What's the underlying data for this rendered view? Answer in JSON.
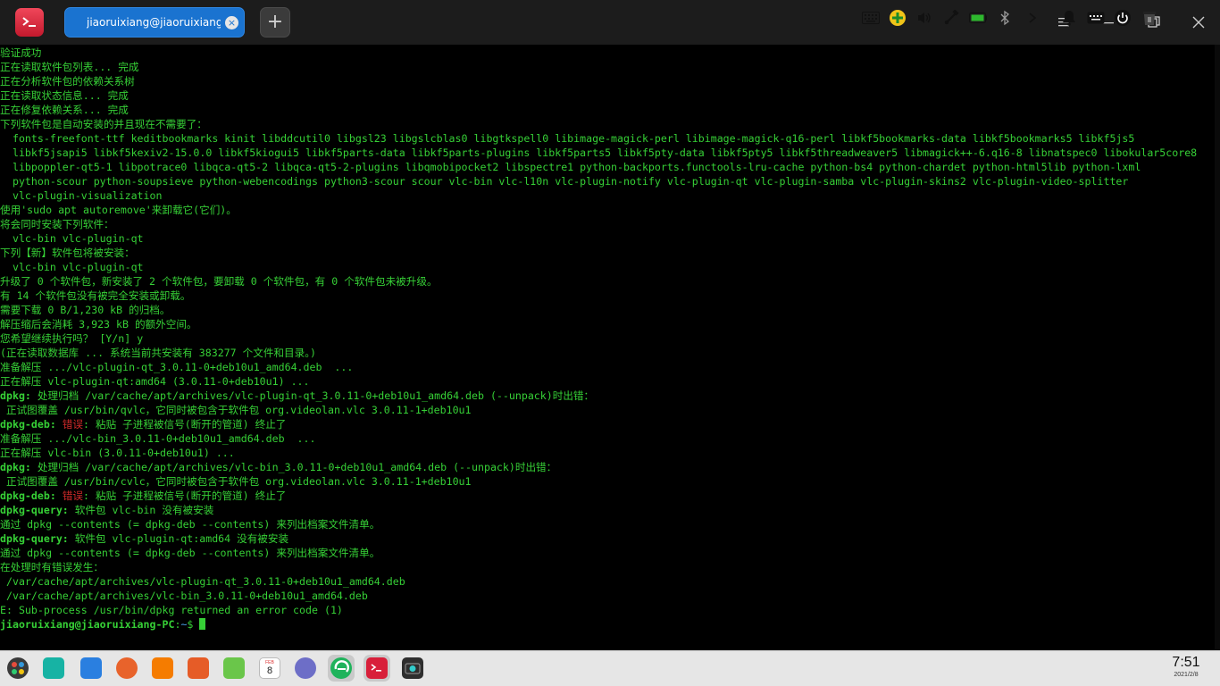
{
  "window": {
    "tab_title": "jiaoruixiang@jiaoruixiang-PC: ~",
    "tab_close_glyph": "×",
    "new_tab_glyph": "+"
  },
  "terminal": {
    "lines": [
      [
        {
          "t": "验证成功"
        }
      ],
      [
        {
          "t": "正在读取软件包列表... 完成"
        }
      ],
      [
        {
          "t": "正在分析软件包的依赖关系树"
        }
      ],
      [
        {
          "t": "正在读取状态信息... 完成"
        }
      ],
      [
        {
          "t": "正在修复依赖关系... 完成"
        }
      ],
      [
        {
          "t": "下列软件包是自动安装的并且现在不需要了："
        }
      ],
      [
        {
          "t": "  fonts-freefont-ttf keditbookmarks kinit libddcutil0 libgsl23 libgslcblas0 libgtkspell0 libimage-magick-perl libimage-magick-q16-perl libkf5bookmarks-data libkf5bookmarks5 libkf5js5"
        }
      ],
      [
        {
          "t": "  libkf5jsapi5 libkf5kexiv2-15.0.0 libkf5kiogui5 libkf5parts-data libkf5parts-plugins libkf5parts5 libkf5pty-data libkf5pty5 libkf5threadweaver5 libmagick++-6.q16-8 libnatspec0 libokular5core8"
        }
      ],
      [
        {
          "t": "  libpoppler-qt5-1 libpotrace0 libqca-qt5-2 libqca-qt5-2-plugins libqmobipocket2 libspectre1 python-backports.functools-lru-cache python-bs4 python-chardet python-html5lib python-lxml"
        }
      ],
      [
        {
          "t": "  python-scour python-soupsieve python-webencodings python3-scour scour vlc-bin vlc-l10n vlc-plugin-notify vlc-plugin-qt vlc-plugin-samba vlc-plugin-skins2 vlc-plugin-video-splitter"
        }
      ],
      [
        {
          "t": "  vlc-plugin-visualization"
        }
      ],
      [
        {
          "t": "使用'sudo apt autoremove'来卸载它(它们)。"
        }
      ],
      [
        {
          "t": "将会同时安装下列软件："
        }
      ],
      [
        {
          "t": "  vlc-bin vlc-plugin-qt"
        }
      ],
      [
        {
          "t": "下列【新】软件包将被安装："
        }
      ],
      [
        {
          "t": "  vlc-bin vlc-plugin-qt"
        }
      ],
      [
        {
          "t": "升级了 0 个软件包，新安装了 2 个软件包，要卸载 0 个软件包，有 0 个软件包未被升级。"
        }
      ],
      [
        {
          "t": "有 14 个软件包没有被完全安装或卸载。"
        }
      ],
      [
        {
          "t": "需要下载 0 B/1,230 kB 的归档。"
        }
      ],
      [
        {
          "t": "解压缩后会消耗 3,923 kB 的额外空间。"
        }
      ],
      [
        {
          "t": "您希望继续执行吗？ [Y/n] y"
        }
      ],
      [
        {
          "t": "(正在读取数据库 ... 系统当前共安装有 383277 个文件和目录。)"
        }
      ],
      [
        {
          "t": "准备解压 .../vlc-plugin-qt_3.0.11-0+deb10u1_amd64.deb  ..."
        }
      ],
      [
        {
          "t": "正在解压 vlc-plugin-qt:amd64 (3.0.11-0+deb10u1) ..."
        }
      ],
      [
        {
          "t": "dpkg:",
          "c": "b"
        },
        {
          "t": " 处理归档 /var/cache/apt/archives/vlc-plugin-qt_3.0.11-0+deb10u1_amd64.deb (--unpack)时出错："
        }
      ],
      [
        {
          "t": " 正试图覆盖 /usr/bin/qvlc，它同时被包含于软件包 org.videolan.vlc 3.0.11-1+deb10u1"
        }
      ],
      [
        {
          "t": "dpkg-deb:",
          "c": "b"
        },
        {
          "t": " "
        },
        {
          "t": "错误",
          "c": "r"
        },
        {
          "t": ": 粘贴 子进程被信号(断开的管道) 终止了"
        }
      ],
      [
        {
          "t": "准备解压 .../vlc-bin_3.0.11-0+deb10u1_amd64.deb  ..."
        }
      ],
      [
        {
          "t": "正在解压 vlc-bin (3.0.11-0+deb10u1) ..."
        }
      ],
      [
        {
          "t": "dpkg:",
          "c": "b"
        },
        {
          "t": " 处理归档 /var/cache/apt/archives/vlc-bin_3.0.11-0+deb10u1_amd64.deb (--unpack)时出错："
        }
      ],
      [
        {
          "t": " 正试图覆盖 /usr/bin/cvlc，它同时被包含于软件包 org.videolan.vlc 3.0.11-1+deb10u1"
        }
      ],
      [
        {
          "t": "dpkg-deb:",
          "c": "b"
        },
        {
          "t": " "
        },
        {
          "t": "错误",
          "c": "r"
        },
        {
          "t": ": 粘贴 子进程被信号(断开的管道) 终止了"
        }
      ],
      [
        {
          "t": "dpkg-query:",
          "c": "b"
        },
        {
          "t": " 软件包 vlc-bin 没有被安装"
        }
      ],
      [
        {
          "t": "通过 dpkg --contents (= dpkg-deb --contents) 来列出档案文件清单。"
        }
      ],
      [
        {
          "t": "dpkg-query:",
          "c": "b"
        },
        {
          "t": " 软件包 vlc-plugin-qt:amd64 没有被安装"
        }
      ],
      [
        {
          "t": "通过 dpkg --contents (= dpkg-deb --contents) 来列出档案文件清单。"
        }
      ],
      [
        {
          "t": "在处理时有错误发生："
        }
      ],
      [
        {
          "t": " /var/cache/apt/archives/vlc-plugin-qt_3.0.11-0+deb10u1_amd64.deb"
        }
      ],
      [
        {
          "t": " /var/cache/apt/archives/vlc-bin_3.0.11-0+deb10u1_amd64.deb"
        }
      ],
      [
        {
          "t": "E: Sub-process /usr/bin/dpkg returned an error code (1)"
        }
      ]
    ],
    "prompt": {
      "user_host": "jiaoruixiang@jiaoruixiang-PC",
      "colon": ":",
      "path": "~",
      "symbol": "$ "
    }
  },
  "dock": {
    "apps": [
      {
        "name": "launcher-icon",
        "color": "#3a3a3a"
      },
      {
        "name": "file-manager-icon",
        "color": "#17b3a4"
      },
      {
        "name": "app-store-icon",
        "color": "#2a7fe0"
      },
      {
        "name": "firefox-icon",
        "color": "#e8632b"
      },
      {
        "name": "office-icon",
        "color": "#f57c00"
      },
      {
        "name": "image-viewer-icon",
        "color": "#e65c27"
      },
      {
        "name": "music-icon",
        "color": "#6ac64a"
      },
      {
        "name": "calendar-icon",
        "color": "#ffffff"
      },
      {
        "name": "settings-icon",
        "color": "#6d6ec7"
      },
      {
        "name": "browser-icon",
        "color": "#1fb35b"
      },
      {
        "name": "terminal-icon",
        "color": "#d81f3a"
      },
      {
        "name": "screenshot-icon",
        "color": "#2e2e2e"
      }
    ],
    "calendar_day": "8",
    "calendar_month": "FEB",
    "clock_time": "7:51",
    "clock_date": "2021/2/8"
  }
}
